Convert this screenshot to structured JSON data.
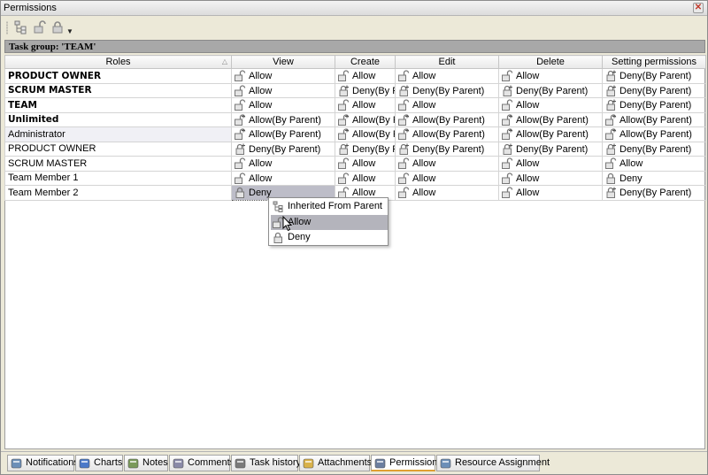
{
  "window": {
    "title": "Permissions"
  },
  "group": {
    "label": "Task group: 'TEAM'"
  },
  "columns": [
    "Roles",
    "View",
    "Create",
    "Edit",
    "Delete",
    "Setting permissions"
  ],
  "rows": [
    {
      "role": "PRODUCT OWNER",
      "bold": true,
      "cells": [
        {
          "text": "Allow",
          "icon": "unlock-icon"
        },
        {
          "text": "Allow",
          "icon": "unlock-icon"
        },
        {
          "text": "Allow",
          "icon": "unlock-icon"
        },
        {
          "text": "Allow",
          "icon": "unlock-icon"
        },
        {
          "text": "Deny(By Parent)",
          "icon": "inherited-lock-icon"
        }
      ]
    },
    {
      "role": "SCRUM MASTER",
      "bold": true,
      "cells": [
        {
          "text": "Allow",
          "icon": "unlock-icon"
        },
        {
          "text": "Deny(By P",
          "icon": "inherited-lock-icon"
        },
        {
          "text": "Deny(By Parent)",
          "icon": "inherited-lock-icon"
        },
        {
          "text": "Deny(By Parent)",
          "icon": "inherited-lock-icon"
        },
        {
          "text": "Deny(By Parent)",
          "icon": "inherited-lock-icon"
        }
      ]
    },
    {
      "role": "TEAM",
      "bold": true,
      "cells": [
        {
          "text": "Allow",
          "icon": "unlock-icon"
        },
        {
          "text": "Allow",
          "icon": "unlock-icon"
        },
        {
          "text": "Allow",
          "icon": "unlock-icon"
        },
        {
          "text": "Allow",
          "icon": "unlock-icon"
        },
        {
          "text": "Deny(By Parent)",
          "icon": "inherited-lock-icon"
        }
      ]
    },
    {
      "role": "Unlimited",
      "bold": true,
      "cells": [
        {
          "text": "Allow(By Parent)",
          "icon": "inherited-unlock-icon"
        },
        {
          "text": "Allow(By P",
          "icon": "inherited-unlock-icon"
        },
        {
          "text": "Allow(By Parent)",
          "icon": "inherited-unlock-icon"
        },
        {
          "text": "Allow(By Parent)",
          "icon": "inherited-unlock-icon"
        },
        {
          "text": "Allow(By Parent)",
          "icon": "inherited-unlock-icon"
        }
      ]
    },
    {
      "role": "Administrator",
      "bold": false,
      "selected": true,
      "cells": [
        {
          "text": "Allow(By Parent)",
          "icon": "inherited-unlock-icon"
        },
        {
          "text": "Allow(By P",
          "icon": "inherited-unlock-icon"
        },
        {
          "text": "Allow(By Parent)",
          "icon": "inherited-unlock-icon"
        },
        {
          "text": "Allow(By Parent)",
          "icon": "inherited-unlock-icon"
        },
        {
          "text": "Allow(By Parent)",
          "icon": "inherited-unlock-icon"
        }
      ]
    },
    {
      "role": "PRODUCT OWNER",
      "bold": false,
      "cells": [
        {
          "text": "Deny(By Parent)",
          "icon": "inherited-lock-icon"
        },
        {
          "text": "Deny(By P",
          "icon": "inherited-lock-icon"
        },
        {
          "text": "Deny(By Parent)",
          "icon": "inherited-lock-icon"
        },
        {
          "text": "Deny(By Parent)",
          "icon": "inherited-lock-icon"
        },
        {
          "text": "Deny(By Parent)",
          "icon": "inherited-lock-icon"
        }
      ]
    },
    {
      "role": "SCRUM MASTER",
      "bold": false,
      "cells": [
        {
          "text": "Allow",
          "icon": "unlock-icon"
        },
        {
          "text": "Allow",
          "icon": "unlock-icon"
        },
        {
          "text": "Allow",
          "icon": "unlock-icon"
        },
        {
          "text": "Allow",
          "icon": "unlock-icon"
        },
        {
          "text": "Allow",
          "icon": "unlock-icon"
        }
      ]
    },
    {
      "role": "Team Member 1",
      "bold": false,
      "cells": [
        {
          "text": "Allow",
          "icon": "unlock-icon"
        },
        {
          "text": "Allow",
          "icon": "unlock-icon"
        },
        {
          "text": "Allow",
          "icon": "unlock-icon"
        },
        {
          "text": "Allow",
          "icon": "unlock-icon"
        },
        {
          "text": "Deny",
          "icon": "lock-icon"
        }
      ]
    },
    {
      "role": "Team Member 2",
      "bold": false,
      "cells": [
        {
          "text": "Deny",
          "icon": "lock-icon",
          "active": true
        },
        {
          "text": "Allow",
          "icon": "unlock-icon"
        },
        {
          "text": "Allow",
          "icon": "unlock-icon"
        },
        {
          "text": "Allow",
          "icon": "unlock-icon"
        },
        {
          "text": "Deny(By Parent)",
          "icon": "inherited-lock-icon"
        }
      ]
    }
  ],
  "context_menu": {
    "items": [
      {
        "label": "Inherited From Parent",
        "icon": "inherit-tree-icon"
      },
      {
        "label": "Allow",
        "icon": "unlock-icon",
        "highlighted": true
      },
      {
        "label": "Deny",
        "icon": "lock-icon"
      }
    ]
  },
  "tabs": [
    {
      "label": "Notifications",
      "icon": "notifications-icon"
    },
    {
      "label": "Charts",
      "icon": "charts-icon"
    },
    {
      "label": "Notes",
      "icon": "notes-icon"
    },
    {
      "label": "Comments",
      "icon": "comments-icon"
    },
    {
      "label": "Task history",
      "icon": "task-history-icon"
    },
    {
      "label": "Attachments",
      "icon": "attachments-icon"
    },
    {
      "label": "Permissions",
      "icon": "permissions-key-icon",
      "active": true
    },
    {
      "label": "Resource Assignment",
      "icon": "resource-assignment-icon"
    }
  ]
}
